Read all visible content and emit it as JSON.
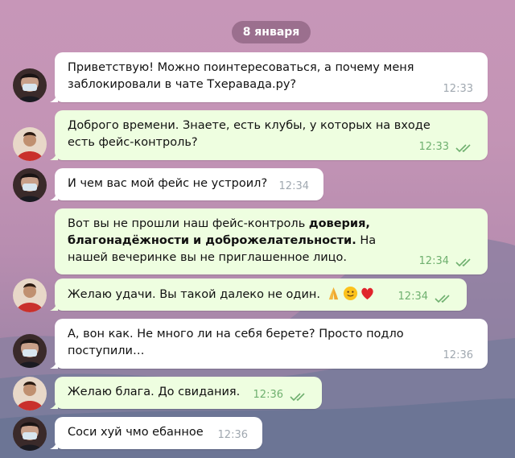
{
  "date_label": "8 января",
  "messages": [
    {
      "text": "Приветствую! Можно поинтересоваться, а почему меня заблокировали в чате Тхеравада.ру?",
      "time": "12:33"
    },
    {
      "text": "Доброго времени. Знаете, есть клубы, у которых на входе есть фейс-контроль?",
      "time": "12:33"
    },
    {
      "text": "И чем вас мой фейс не устроил?",
      "time": "12:34"
    },
    {
      "text_pre": "Вот вы не прошли наш фейс-контроль ",
      "text_bold": "доверия, благонадёжности и доброжелательности.",
      "text_post": " На нашей вечеринке вы не приглашенное лицо.",
      "time": "12:34"
    },
    {
      "text": "Желаю удачи.  Вы такой далеко не один. ",
      "time": "12:34"
    },
    {
      "text": "А, вон как. Не много ли на себя берете? Просто подло поступили…",
      "time": "12:36"
    },
    {
      "text": "Желаю блага.  До свидания.",
      "time": "12:36"
    },
    {
      "text": "Соси хуй чмо ебанное",
      "time": "12:36"
    }
  ],
  "icons": {
    "read_receipt": "double-check-icon",
    "emojis": [
      "folded-hands-icon",
      "slightly-smiling-face-icon",
      "red-heart-icon"
    ]
  },
  "colors": {
    "incoming_bubble": "#ffffff",
    "outgoing_bubble": "#eefee0",
    "outgoing_time": "#6fb06f"
  }
}
